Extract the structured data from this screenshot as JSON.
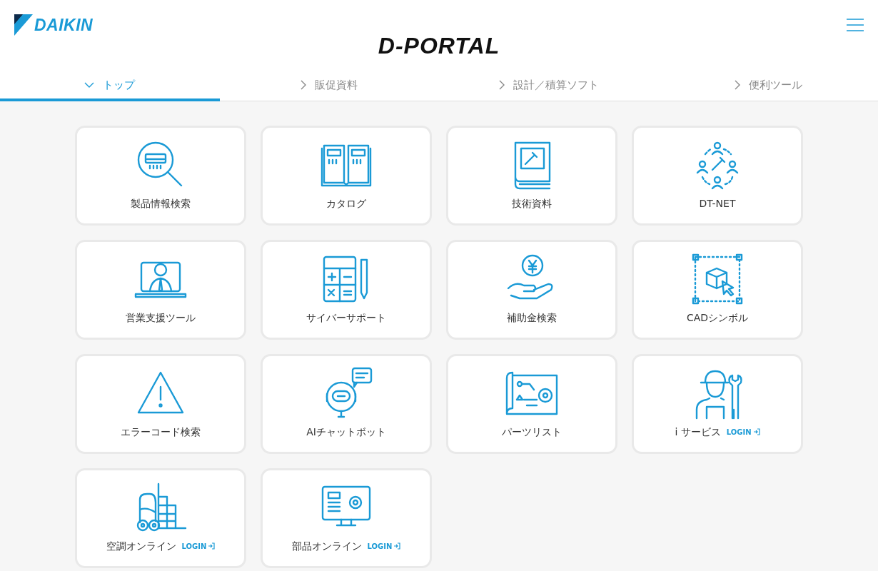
{
  "header": {
    "brand": "DAIKIN",
    "title": "D-PORTAL"
  },
  "tabs": [
    {
      "label": "トップ",
      "selected": true
    },
    {
      "label": "販促資料",
      "selected": false
    },
    {
      "label": "設計／積算ソフト",
      "selected": false
    },
    {
      "label": "便利ツール",
      "selected": false
    }
  ],
  "tiles": [
    {
      "label": "製品情報検索"
    },
    {
      "label": "カタログ"
    },
    {
      "label": "技術資料"
    },
    {
      "label": "DT-NET"
    },
    {
      "label": "営業支援ツール"
    },
    {
      "label": "サイバーサポート"
    },
    {
      "label": "補助金検索"
    },
    {
      "label": "CADシンボル"
    },
    {
      "label": "エラーコード検索"
    },
    {
      "label": "AIチャットボット"
    },
    {
      "label": "パーツリスト"
    },
    {
      "label": "i サービス",
      "login": "LOGIN"
    },
    {
      "label": "空調オンライン",
      "login": "LOGIN"
    },
    {
      "label": "部品オンライン",
      "login": "LOGIN"
    }
  ]
}
